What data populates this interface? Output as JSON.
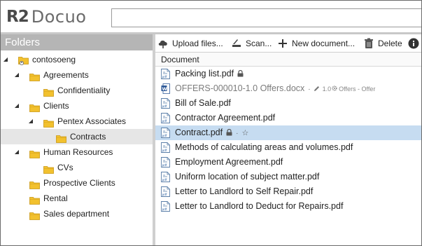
{
  "app": {
    "logo_mark": "R2",
    "logo_text": "Docuo"
  },
  "search": {
    "placeholder": ""
  },
  "folders_panel": {
    "title": "Folders",
    "tree": [
      {
        "label": "contosoeng",
        "level": 0,
        "expanded": true,
        "root": true
      },
      {
        "label": "Agreements",
        "level": 1,
        "expanded": true
      },
      {
        "label": "Confidentiality",
        "level": 2
      },
      {
        "label": "Clients",
        "level": 1,
        "expanded": true
      },
      {
        "label": "Pentex Associates",
        "level": 2,
        "expanded": true
      },
      {
        "label": "Contracts",
        "level": 3,
        "selected": true
      },
      {
        "label": "Human Resources",
        "level": 1,
        "expanded": true
      },
      {
        "label": "CVs",
        "level": 2
      },
      {
        "label": "Prospective Clients",
        "level": 1
      },
      {
        "label": "Rental",
        "level": 1
      },
      {
        "label": "Sales department",
        "level": 1
      }
    ]
  },
  "toolbar": {
    "upload_label": "Upload files...",
    "scan_label": "Scan...",
    "new_doc_label": "New document...",
    "delete_label": "Delete"
  },
  "documents": {
    "column_header": "Document",
    "rows": [
      {
        "name": "Packing list.pdf",
        "type": "pdf",
        "locked": true
      },
      {
        "name": "OFFERS-000010-1.0 Offers.docx",
        "type": "docx",
        "greyed": true,
        "meta_version": "1.0",
        "meta_workflow": "Offers - Offer"
      },
      {
        "name": "Bill of Sale.pdf",
        "type": "pdf"
      },
      {
        "name": "Contractor Agreement.pdf",
        "type": "pdf"
      },
      {
        "name": "Contract.pdf",
        "type": "pdf",
        "locked": true,
        "starred": true,
        "selected": true
      },
      {
        "name": "Methods of calculating areas and volumes.pdf",
        "type": "pdf"
      },
      {
        "name": "Employment Agreement.pdf",
        "type": "pdf"
      },
      {
        "name": "Uniform location of subject matter.pdf",
        "type": "pdf"
      },
      {
        "name": "Letter to Landlord to Self Repair.pdf",
        "type": "pdf"
      },
      {
        "name": "Letter to Landlord to Deduct for Repairs.pdf",
        "type": "pdf"
      }
    ]
  },
  "colors": {
    "selection": "#c6dcf1",
    "folder": "#f2c12e",
    "panel_title": "#b5b5b5",
    "word_blue": "#2b5797"
  }
}
